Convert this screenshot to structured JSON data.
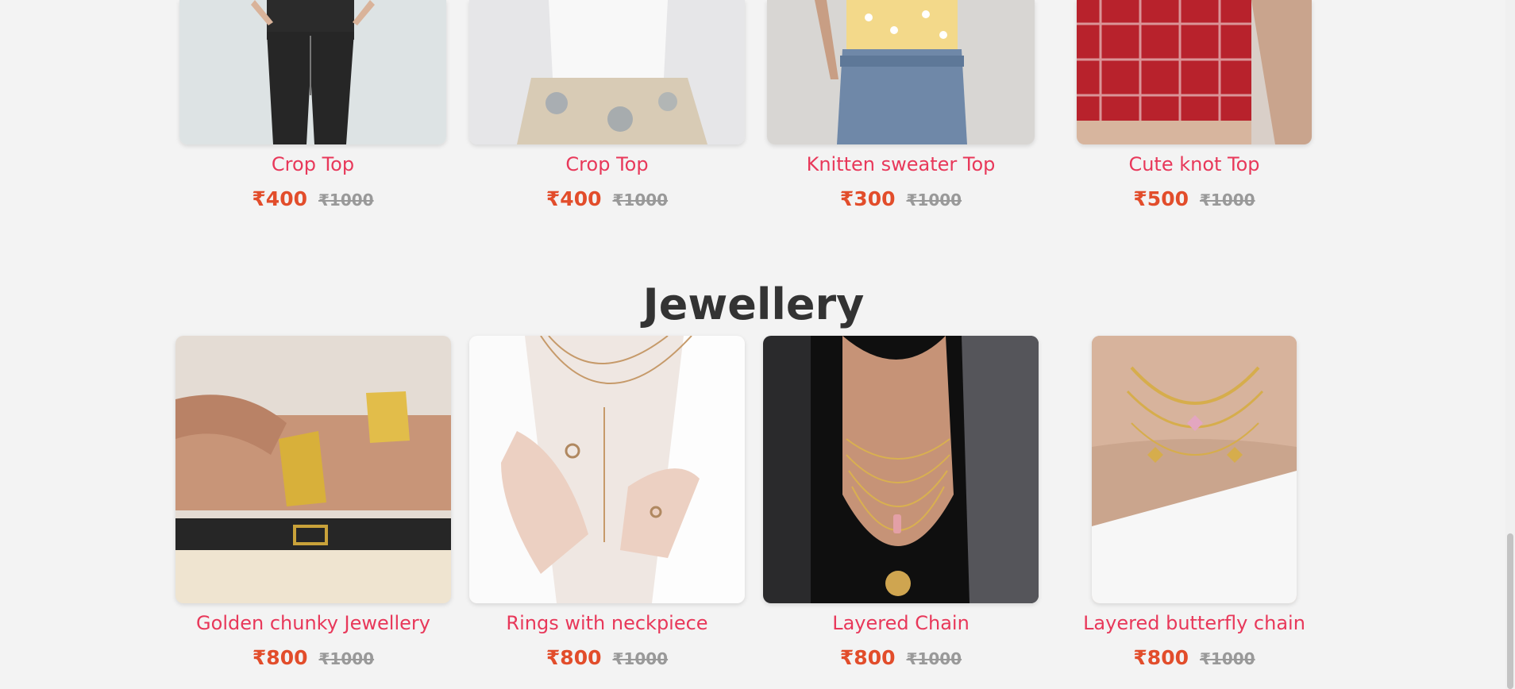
{
  "tops": [
    {
      "name": "Crop Top",
      "price": "₹400",
      "old_price": "₹1000"
    },
    {
      "name": "Crop Top",
      "price": "₹400",
      "old_price": "₹1000"
    },
    {
      "name": "Knitten sweater Top",
      "price": "₹300",
      "old_price": "₹1000"
    },
    {
      "name": "Cute knot Top",
      "price": "₹500",
      "old_price": "₹1000"
    }
  ],
  "jewellery": {
    "title": "Jewellery",
    "items": [
      {
        "name": "Golden chunky Jewellery",
        "price": "₹800",
        "old_price": "₹1000"
      },
      {
        "name": "Rings with neckpiece",
        "price": "₹800",
        "old_price": "₹1000"
      },
      {
        "name": "Layered Chain",
        "price": "₹800",
        "old_price": "₹1000"
      },
      {
        "name": "Layered butterfly chain",
        "price": "₹800",
        "old_price": "₹1000"
      }
    ]
  },
  "colors": {
    "background": "#f3f3f3",
    "product_name": "#e8385a",
    "price": "#e24d2b",
    "old_price": "#999999",
    "heading": "#333333"
  },
  "icons": [
    "product-photo"
  ]
}
